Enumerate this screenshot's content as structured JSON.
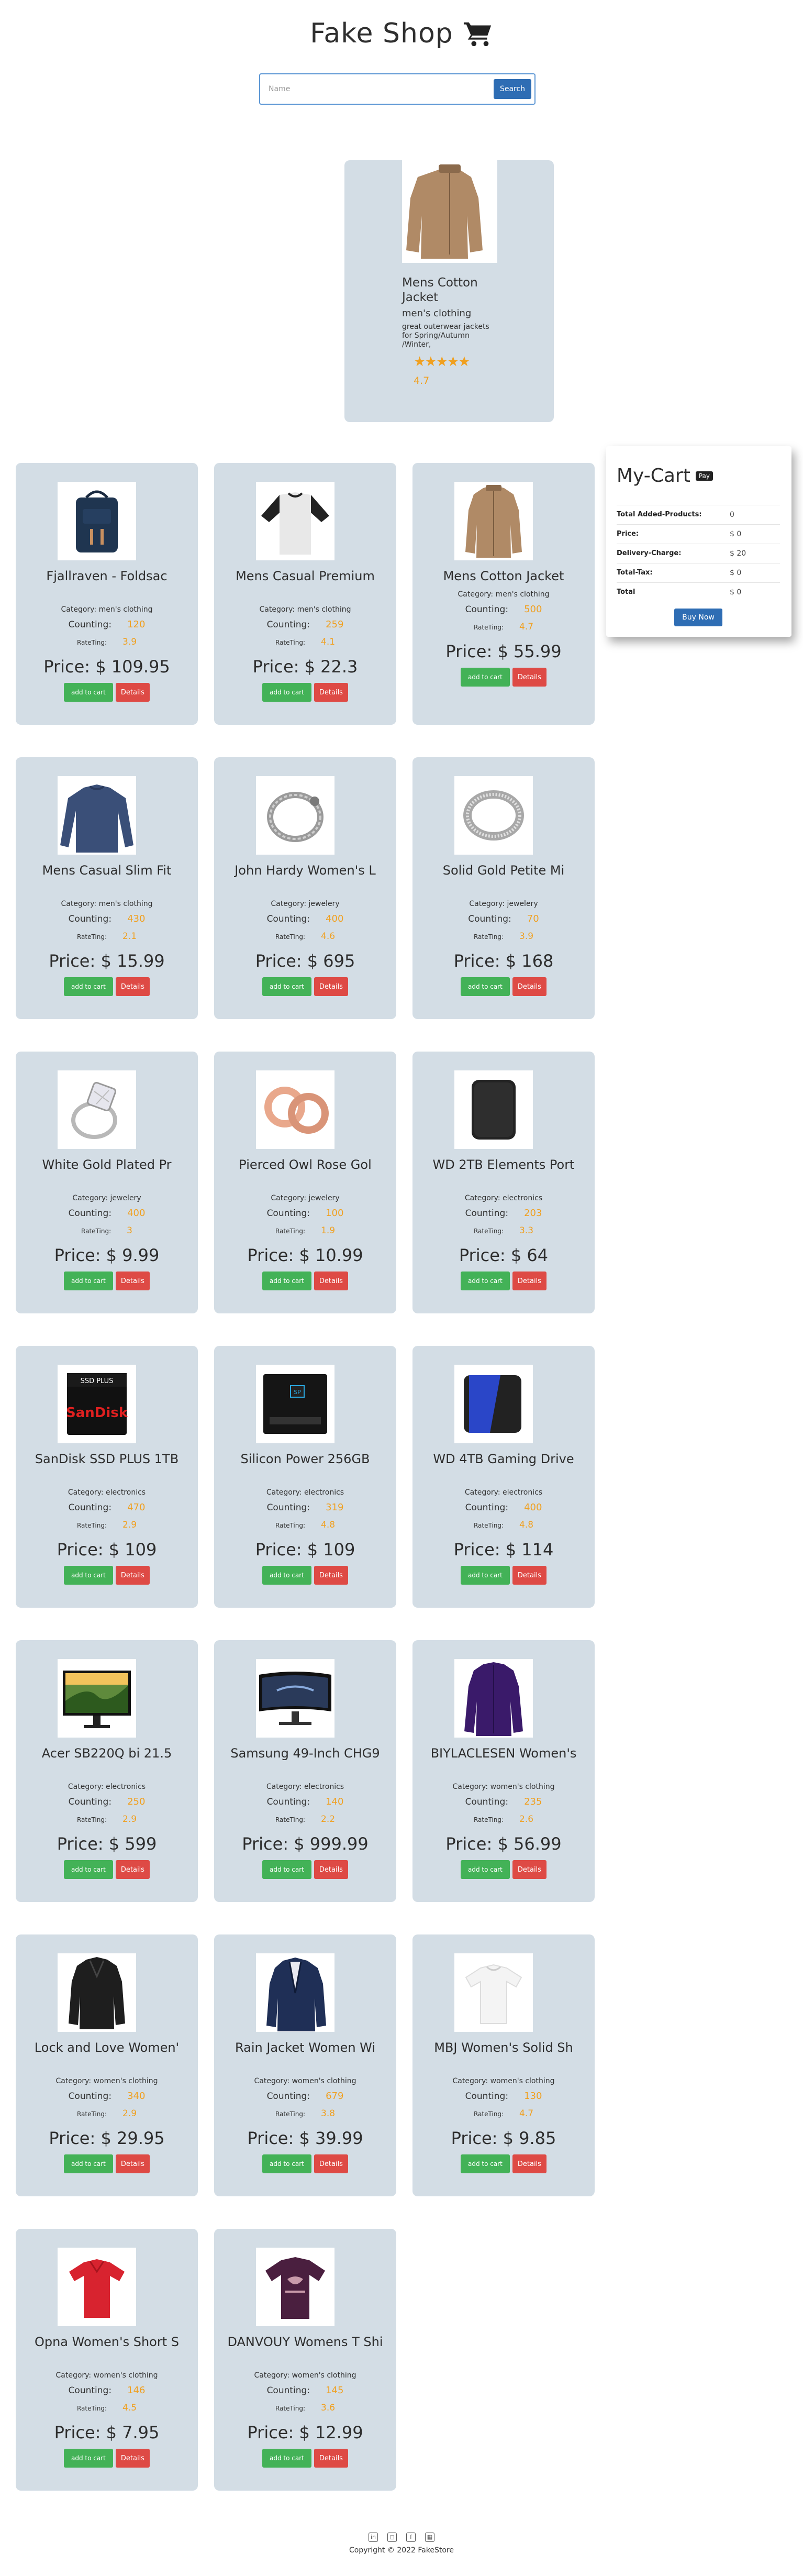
{
  "header": {
    "title": "Fake Shop"
  },
  "search": {
    "placeholder": "Name",
    "button_label": "Search"
  },
  "featured": {
    "title": "Mens Cotton Jacket",
    "category": "men's clothing",
    "description": "great outerwear jackets for Spring/Autumn /Winter,",
    "stars": "★★★★★",
    "rating": "4.7"
  },
  "labels": {
    "category_prefix": "Category:",
    "counting": "Counting:",
    "rating": "RateTing:",
    "price_prefix": "Price: $",
    "add_to_cart": "add to cart",
    "details": "Details"
  },
  "products": [
    {
      "title": "Fjallraven - Foldsac",
      "category": "men's clothing",
      "count": "120",
      "rate": "3.9",
      "price": "109.95",
      "image": "backpack"
    },
    {
      "title": "Mens Casual Premium",
      "category": "men's clothing",
      "count": "259",
      "rate": "4.1",
      "price": "22.3",
      "image": "raglan-tee"
    },
    {
      "title": "Mens Cotton Jacket",
      "category": "men's clothing",
      "count": "500",
      "rate": "4.7",
      "price": "55.99",
      "image": "jacket"
    },
    {
      "title": "Mens Casual Slim Fit",
      "category": "men's clothing",
      "count": "430",
      "rate": "2.1",
      "price": "15.99",
      "image": "longsleeve"
    },
    {
      "title": "John Hardy Women's L",
      "category": "jewelery",
      "count": "400",
      "rate": "4.6",
      "price": "695",
      "image": "bracelet"
    },
    {
      "title": "Solid Gold Petite Mi",
      "category": "jewelery",
      "count": "70",
      "rate": "3.9",
      "price": "168",
      "image": "ring-band"
    },
    {
      "title": "White Gold Plated Pr",
      "category": "jewelery",
      "count": "400",
      "rate": "3",
      "price": "9.99",
      "image": "diamond-ring"
    },
    {
      "title": "Pierced Owl Rose Gol",
      "category": "jewelery",
      "count": "100",
      "rate": "1.9",
      "price": "10.99",
      "image": "earrings"
    },
    {
      "title": "WD 2TB Elements Port",
      "category": "electronics",
      "count": "203",
      "rate": "3.3",
      "price": "64",
      "image": "hdd-black"
    },
    {
      "title": "SanDisk SSD PLUS 1TB",
      "category": "electronics",
      "count": "470",
      "rate": "2.9",
      "price": "109",
      "image": "ssd-sandisk"
    },
    {
      "title": "Silicon Power 256GB",
      "category": "electronics",
      "count": "319",
      "rate": "4.8",
      "price": "109",
      "image": "ssd-sp"
    },
    {
      "title": "WD 4TB Gaming Drive",
      "category": "electronics",
      "count": "400",
      "rate": "4.8",
      "price": "114",
      "image": "hdd-blue"
    },
    {
      "title": "Acer SB220Q bi 21.5",
      "category": "electronics",
      "count": "250",
      "rate": "2.9",
      "price": "599",
      "image": "monitor"
    },
    {
      "title": "Samsung 49-Inch CHG9",
      "category": "electronics",
      "count": "140",
      "rate": "2.2",
      "price": "999.99",
      "image": "curved-monitor"
    },
    {
      "title": "BIYLACLESEN Women's",
      "category": "women's clothing",
      "count": "235",
      "rate": "2.6",
      "price": "56.99",
      "image": "purple-jacket"
    },
    {
      "title": "Lock and Love Women'",
      "category": "women's clothing",
      "count": "340",
      "rate": "2.9",
      "price": "29.95",
      "image": "leather-jacket"
    },
    {
      "title": "Rain Jacket Women Wi",
      "category": "women's clothing",
      "count": "679",
      "rate": "3.8",
      "price": "39.99",
      "image": "blazer"
    },
    {
      "title": "MBJ Women's Solid Sh",
      "category": "women's clothing",
      "count": "130",
      "rate": "4.7",
      "price": "9.85",
      "image": "white-top"
    },
    {
      "title": "Opna Women's Short S",
      "category": "women's clothing",
      "count": "146",
      "rate": "4.5",
      "price": "7.95",
      "image": "red-top"
    },
    {
      "title": "DANVOUY Womens T Shi",
      "category": "women's clothing",
      "count": "145",
      "rate": "3.6",
      "price": "12.99",
      "image": "purple-tee"
    }
  ],
  "cart": {
    "title": "My-Cart",
    "badge": "Pay",
    "rows": [
      {
        "label": "Total Added-Products:",
        "value": "0"
      },
      {
        "label": "Price:",
        "value": "$ 0"
      },
      {
        "label": "Delivery-Charge:",
        "value": "$ 20"
      },
      {
        "label": "Total-Tax:",
        "value": "$ 0"
      },
      {
        "label": "Total",
        "value": "$ 0"
      }
    ],
    "buy_label": "Buy Now"
  },
  "footer": {
    "social_icons": [
      "linkedin-icon",
      "instagram-icon",
      "facebook-icon",
      "github-icon"
    ],
    "social_glyphs": [
      "in",
      "◻",
      "f",
      "▦"
    ],
    "copyright": "Copyright © 2022 FakeStore"
  },
  "colors": {
    "card_bg": "#d3dde5",
    "accent_orange": "#f0a020",
    "add_green": "#43b257",
    "details_red": "#de4a45",
    "primary_blue": "#2e6db4"
  }
}
